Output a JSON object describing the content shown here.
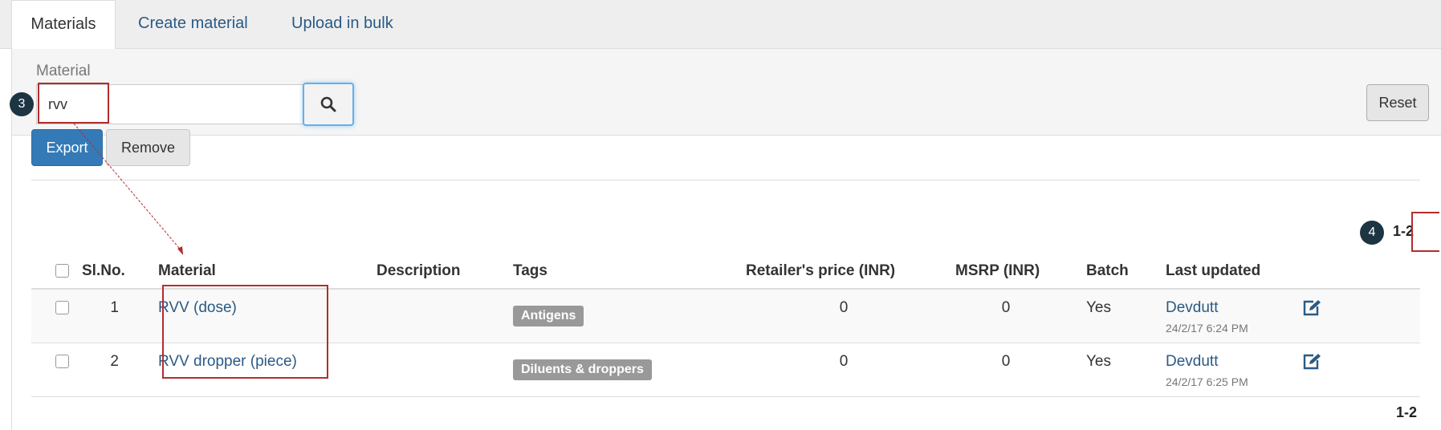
{
  "tabs": [
    {
      "label": "Materials",
      "active": true
    },
    {
      "label": "Create material",
      "active": false
    },
    {
      "label": "Upload in bulk",
      "active": false
    }
  ],
  "filter": {
    "label": "Material",
    "value": "rvv",
    "reset_label": "Reset"
  },
  "actions": {
    "export_label": "Export",
    "remove_label": "Remove"
  },
  "callouts": {
    "search": "3",
    "range": "4"
  },
  "pagination": {
    "top": "1-2",
    "bottom": "1-2"
  },
  "table": {
    "headers": [
      "Sl.No.",
      "Material",
      "Description",
      "Tags",
      "Retailer's price (INR)",
      "MSRP (INR)",
      "Batch",
      "Last updated"
    ],
    "rows": [
      {
        "sl": "1",
        "material": "RVV (dose)",
        "description": "",
        "tag": "Antigens",
        "retailer_price": "0",
        "msrp": "0",
        "batch": "Yes",
        "updated_by": "Devdutt",
        "updated_at": "24/2/17 6:24 PM"
      },
      {
        "sl": "2",
        "material": "RVV dropper (piece)",
        "description": "",
        "tag": "Diluents & droppers",
        "retailer_price": "0",
        "msrp": "0",
        "batch": "Yes",
        "updated_by": "Devdutt",
        "updated_at": "24/2/17 6:25 PM"
      }
    ]
  },
  "colors": {
    "primary": "#337ab7",
    "link": "#2a5a85",
    "callout_box": "#b32d2d",
    "callout_badge": "#1d3443",
    "tag_bg": "#999999"
  },
  "icons": [
    "search-icon",
    "edit-icon"
  ]
}
